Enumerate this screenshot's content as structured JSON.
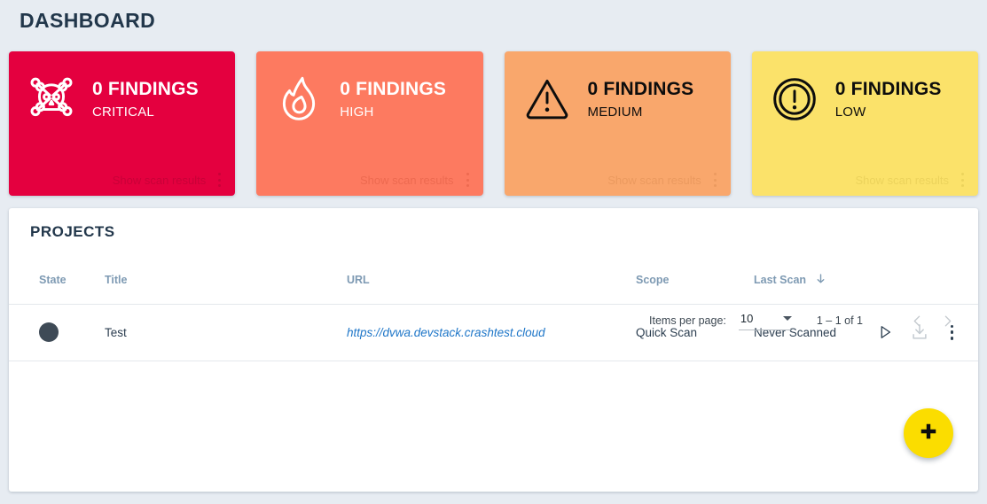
{
  "page": {
    "title": "DASHBOARD",
    "background_color": "#e7ecf2",
    "title_color": "#22374b"
  },
  "severity_cards": [
    {
      "id": "critical",
      "count_label": "0 FINDINGS",
      "severity_label": "CRITICAL",
      "footer_label": "Show scan results",
      "icon": "skull-crossbones-icon",
      "background_color": "#e4003f",
      "text_color": "#ffffff"
    },
    {
      "id": "high",
      "count_label": "0 FINDINGS",
      "severity_label": "HIGH",
      "footer_label": "Show scan results",
      "icon": "flame-icon",
      "background_color": "#fd7a60",
      "text_color": "#ffffff"
    },
    {
      "id": "medium",
      "count_label": "0 FINDINGS",
      "severity_label": "MEDIUM",
      "footer_label": "Show scan results",
      "icon": "warning-triangle-icon",
      "background_color": "#f9a76c",
      "text_color": "#0d0d0d"
    },
    {
      "id": "low",
      "count_label": "0 FINDINGS",
      "severity_label": "LOW",
      "footer_label": "Show scan results",
      "icon": "exclamation-circle-icon",
      "background_color": "#fbe26a",
      "text_color": "#0d0d0d"
    }
  ],
  "projects": {
    "title": "PROJECTS",
    "columns": {
      "state": "State",
      "title": "Title",
      "url": "URL",
      "scope": "Scope",
      "last_scan": "Last Scan"
    },
    "sorted_by": "Last Scan",
    "sort_direction_icon": "arrow-down-icon",
    "rows": [
      {
        "state_color": "#3e4a56",
        "title": "Test",
        "url": "https://dvwa.devstack.crashtest.cloud",
        "url_color": "#1e76c8",
        "scope": "Quick Scan",
        "last_scan": "Never Scanned",
        "actions": {
          "start_scan": "play-icon",
          "download_report": "download-icon",
          "more": "more-vertical-icon"
        }
      }
    ]
  },
  "paginator": {
    "items_per_page_label": "Items per page:",
    "items_per_page_value": "10",
    "range_label": "1 – 1 of 1",
    "previous_icon": "chevron-left-icon",
    "next_icon": "chevron-right-icon"
  },
  "fab": {
    "icon": "plus-icon",
    "color": "#fbdd00"
  }
}
